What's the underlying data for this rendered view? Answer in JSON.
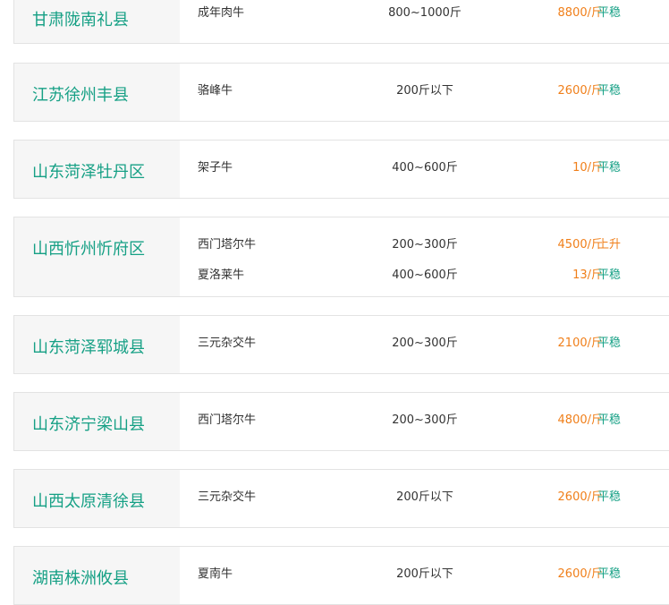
{
  "markets": [
    {
      "region": "甘肃陇南礼县",
      "items": [
        {
          "breed": "成年肉牛",
          "weight": "800~1000斤",
          "price": "8800/斤",
          "trend": "平稳",
          "trend_dir": "flat"
        }
      ]
    },
    {
      "region": "江苏徐州丰县",
      "items": [
        {
          "breed": "骆峰牛",
          "weight": "200斤以下",
          "price": "2600/斤",
          "trend": "平稳",
          "trend_dir": "flat"
        }
      ]
    },
    {
      "region": "山东菏泽牡丹区",
      "items": [
        {
          "breed": "架子牛",
          "weight": "400~600斤",
          "price": "10/斤",
          "trend": "平稳",
          "trend_dir": "flat"
        }
      ]
    },
    {
      "region": "山西忻州忻府区",
      "items": [
        {
          "breed": "西门塔尔牛",
          "weight": "200~300斤",
          "price": "4500/斤",
          "trend": "上升",
          "trend_dir": "up"
        },
        {
          "breed": "夏洛莱牛",
          "weight": "400~600斤",
          "price": "13/斤",
          "trend": "平稳",
          "trend_dir": "flat"
        }
      ]
    },
    {
      "region": "山东菏泽郓城县",
      "items": [
        {
          "breed": "三元杂交牛",
          "weight": "200~300斤",
          "price": "2100/斤",
          "trend": "平稳",
          "trend_dir": "flat"
        }
      ]
    },
    {
      "region": "山东济宁梁山县",
      "items": [
        {
          "breed": "西门塔尔牛",
          "weight": "200~300斤",
          "price": "4800/斤",
          "trend": "平稳",
          "trend_dir": "flat"
        }
      ]
    },
    {
      "region": "山西太原清徐县",
      "items": [
        {
          "breed": "三元杂交牛",
          "weight": "200斤以下",
          "price": "2600/斤",
          "trend": "平稳",
          "trend_dir": "flat"
        }
      ]
    },
    {
      "region": "湖南株洲攸县",
      "items": [
        {
          "breed": "夏南牛",
          "weight": "200斤以下",
          "price": "2600/斤",
          "trend": "平稳",
          "trend_dir": "flat"
        }
      ]
    }
  ]
}
